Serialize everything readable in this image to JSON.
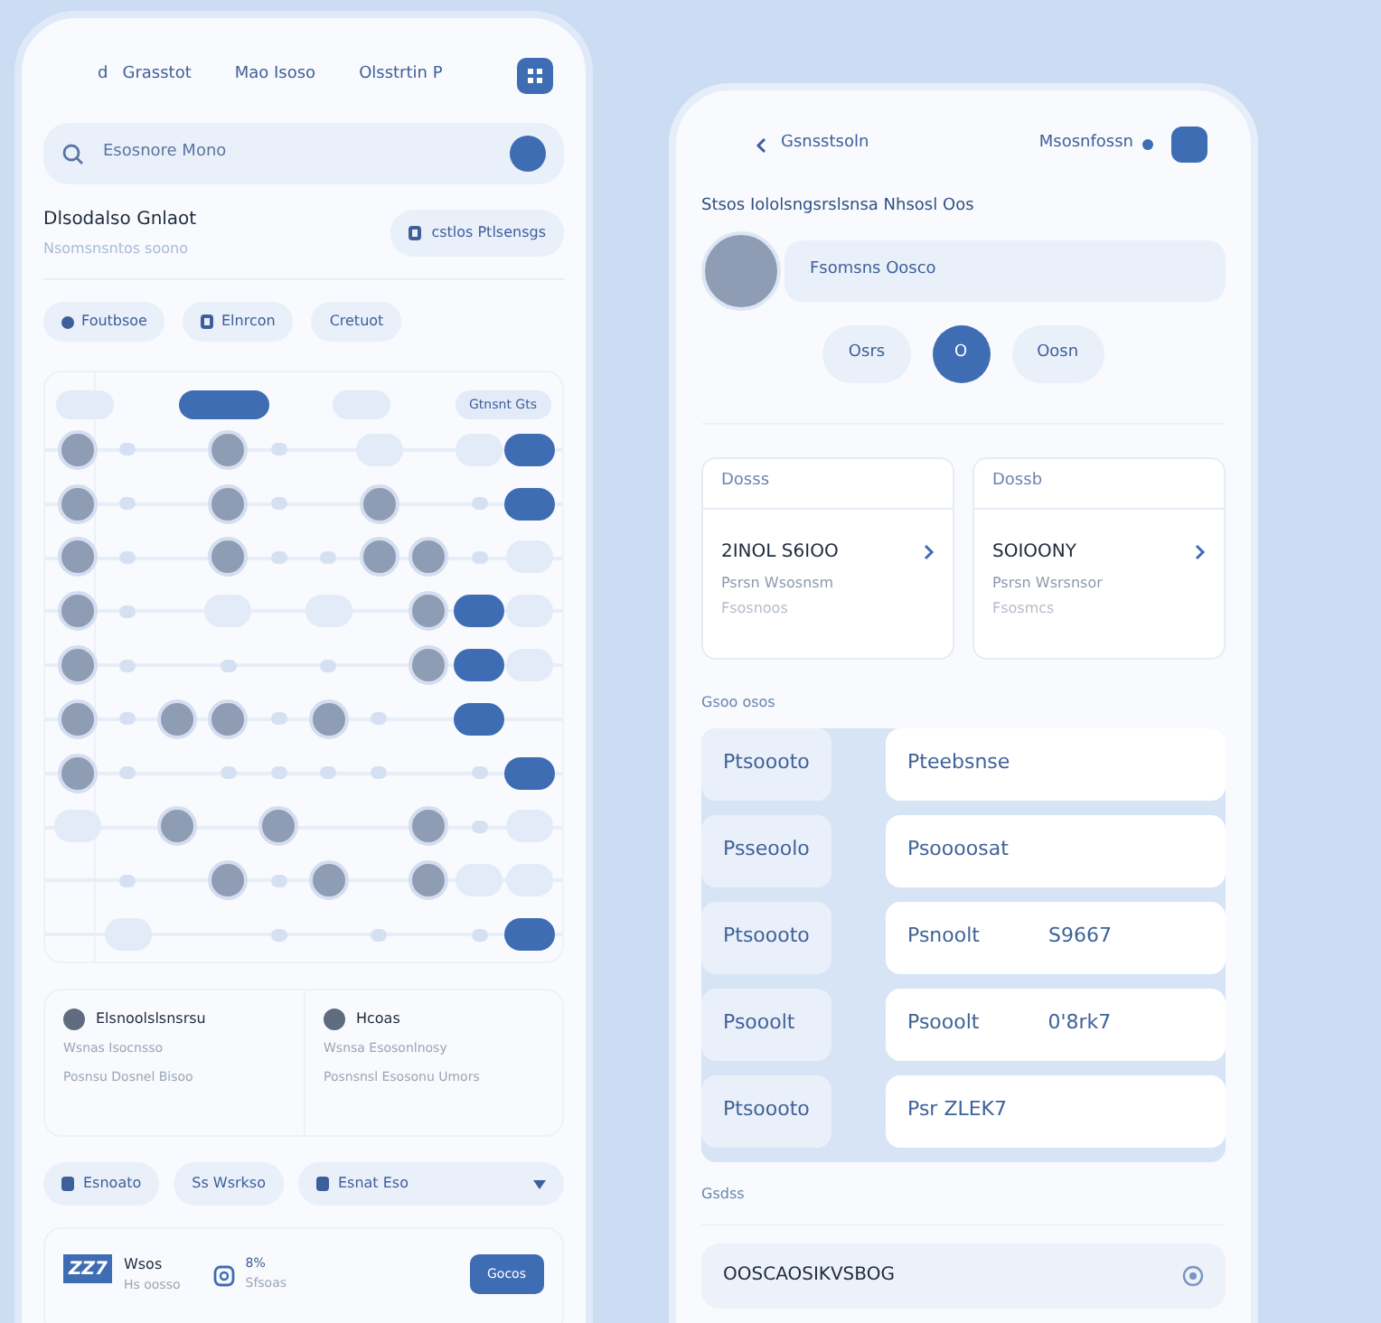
{
  "left_phone": {
    "header": {
      "back_label": "d",
      "items": [
        "Grasstot",
        "Mao Isoso",
        "Olsstrtin P"
      ]
    },
    "search": {
      "placeholder": "Esosnore Mono"
    },
    "title": "Dlsodalso Gnlaot",
    "subtitle": "Nsomsnsntos soono",
    "action": "cstlos Ptlsensgs",
    "chips": [
      {
        "label": "Foutbsoe",
        "kind": "dot"
      },
      {
        "label": "Elnrcon",
        "kind": "tag"
      },
      {
        "label": "Cretuot",
        "kind": "plain"
      }
    ],
    "diagram": {
      "top": [
        {
          "selected": false
        },
        {
          "selected": true
        },
        {
          "selected": false
        },
        {
          "label": "Gtnsnt Gts",
          "selected": false
        }
      ],
      "rows": [
        {
          "cells": [
            {
              "kind": "avatar"
            },
            {
              "kind": "dot"
            },
            {
              "kind": "empty"
            },
            {
              "kind": "avatar"
            },
            {
              "kind": "dot"
            },
            {
              "kind": "empty"
            },
            {
              "kind": "pill"
            },
            {
              "kind": "empty"
            },
            {
              "kind": "pill"
            },
            {
              "kind": "active"
            }
          ]
        },
        {
          "cells": [
            {
              "kind": "avatar"
            },
            {
              "kind": "dot"
            },
            {
              "kind": "empty"
            },
            {
              "kind": "avatar"
            },
            {
              "kind": "dot"
            },
            {
              "kind": "empty"
            },
            {
              "kind": "avatar"
            },
            {
              "kind": "empty"
            },
            {
              "kind": "dot"
            },
            {
              "kind": "active"
            }
          ]
        },
        {
          "cells": [
            {
              "kind": "avatar"
            },
            {
              "kind": "dot"
            },
            {
              "kind": "empty"
            },
            {
              "kind": "avatar"
            },
            {
              "kind": "dot"
            },
            {
              "kind": "dot"
            },
            {
              "kind": "avatar"
            },
            {
              "kind": "avatar"
            },
            {
              "kind": "dot"
            },
            {
              "kind": "pill"
            }
          ]
        },
        {
          "cells": [
            {
              "kind": "avatar"
            },
            {
              "kind": "dot"
            },
            {
              "kind": "empty"
            },
            {
              "kind": "pill"
            },
            {
              "kind": "empty"
            },
            {
              "kind": "pill"
            },
            {
              "kind": "empty"
            },
            {
              "kind": "avatar"
            },
            {
              "kind": "active"
            },
            {
              "kind": "pill"
            }
          ]
        },
        {
          "cells": [
            {
              "kind": "avatar"
            },
            {
              "kind": "dot"
            },
            {
              "kind": "empty"
            },
            {
              "kind": "dot"
            },
            {
              "kind": "empty"
            },
            {
              "kind": "dot"
            },
            {
              "kind": "empty"
            },
            {
              "kind": "avatar"
            },
            {
              "kind": "active"
            },
            {
              "kind": "pill"
            }
          ]
        },
        {
          "cells": [
            {
              "kind": "avatar"
            },
            {
              "kind": "dot"
            },
            {
              "kind": "avatar"
            },
            {
              "kind": "avatar"
            },
            {
              "kind": "dot"
            },
            {
              "kind": "avatar"
            },
            {
              "kind": "dot"
            },
            {
              "kind": "empty"
            },
            {
              "kind": "active"
            },
            {
              "kind": "empty"
            }
          ]
        },
        {
          "cells": [
            {
              "kind": "avatar"
            },
            {
              "kind": "dot"
            },
            {
              "kind": "empty"
            },
            {
              "kind": "dot"
            },
            {
              "kind": "dot"
            },
            {
              "kind": "dot"
            },
            {
              "kind": "dot"
            },
            {
              "kind": "empty"
            },
            {
              "kind": "dot"
            },
            {
              "kind": "active"
            }
          ]
        },
        {
          "cells": [
            {
              "kind": "pill"
            },
            {
              "kind": "empty"
            },
            {
              "kind": "avatar"
            },
            {
              "kind": "empty"
            },
            {
              "kind": "avatar"
            },
            {
              "kind": "empty"
            },
            {
              "kind": "empty"
            },
            {
              "kind": "avatar"
            },
            {
              "kind": "dot"
            },
            {
              "kind": "pill"
            }
          ]
        },
        {
          "cells": [
            {
              "kind": "empty"
            },
            {
              "kind": "dot"
            },
            {
              "kind": "empty"
            },
            {
              "kind": "avatar"
            },
            {
              "kind": "dot"
            },
            {
              "kind": "avatar"
            },
            {
              "kind": "empty"
            },
            {
              "kind": "avatar"
            },
            {
              "kind": "pill"
            },
            {
              "kind": "pill"
            }
          ]
        },
        {
          "cells": [
            {
              "kind": "empty"
            },
            {
              "kind": "pill"
            },
            {
              "kind": "empty"
            },
            {
              "kind": "empty"
            },
            {
              "kind": "dot"
            },
            {
              "kind": "empty"
            },
            {
              "kind": "dot"
            },
            {
              "kind": "empty"
            },
            {
              "kind": "dot"
            },
            {
              "kind": "active"
            }
          ]
        }
      ]
    },
    "cards": [
      {
        "title": "Elsnoolslsnsrsu",
        "lines": [
          "Wsnas Isocnsso",
          "Posnsu Dosnel Bisoo"
        ]
      },
      {
        "title": "Hcoas",
        "lines": [
          "Wsnsa Esosonlnosy",
          "Posnsnsl Esosonu Umors"
        ]
      }
    ],
    "filters": [
      {
        "label": "Esnoato",
        "kind": "icon"
      },
      {
        "label": "Ss Wsrkso",
        "kind": "plain"
      },
      {
        "label": "Esnat Eso",
        "kind": "dropdown"
      }
    ],
    "footer": {
      "logo": "ZZ7",
      "name": "Wsos",
      "sub": "Hs oosso",
      "stat": "8%",
      "stat_sub": "Sfsoas",
      "button": "Gocos"
    }
  },
  "right_phone": {
    "header": {
      "back": "Gsnsstsoln",
      "right": "Msosnfossn"
    },
    "heading": "Stsos Iololsngsrslsnsa Nhsosl Oos",
    "profile_field": "Fsomsns Oosco",
    "segments": [
      {
        "label": "Osrs",
        "selected": false
      },
      {
        "label": "O",
        "selected": true
      },
      {
        "label": "Oosn",
        "selected": false
      }
    ],
    "cards": [
      {
        "header": "Dosss",
        "value": "2INOL S6IOO",
        "line1": "Psrsn Wsosnsm",
        "line2": "Fsosnoos"
      },
      {
        "header": "Dossb",
        "value": "SOIOONY",
        "line1": "Psrsn Wsrsnsor",
        "line2": "Fsosmcs"
      }
    ],
    "section": "Gsoo osos",
    "rows": [
      {
        "label": "Ptsoooto",
        "value": "Pteebsnse"
      },
      {
        "label": "Psseoolo",
        "value": "Psoooosat"
      },
      {
        "label": "Ptsoooto",
        "value": "Psnoolt",
        "amount": "S9667"
      },
      {
        "label": "Psooolt",
        "value": "Psooolt",
        "amount": "0'8rk7"
      },
      {
        "label": "Ptsoooto",
        "value": "Psr ZLEK7"
      }
    ],
    "footer_label": "Gsdss",
    "footer_field": "OOSCAOSIKVSBOG"
  }
}
